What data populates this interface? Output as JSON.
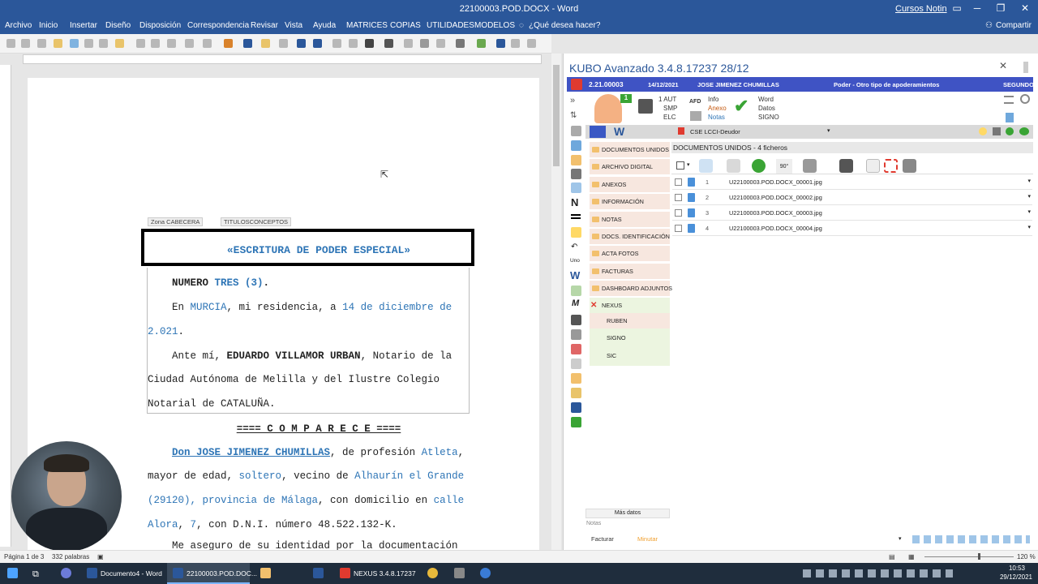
{
  "word": {
    "title": "22100003.POD.DOCX  -  Word",
    "user": "Cursos Notin",
    "menu": [
      "Archivo",
      "Inicio",
      "Insertar",
      "Diseño",
      "Disposición",
      "Correspondencia",
      "Revisar",
      "Vista",
      "Ayuda",
      "MATRICES",
      "COPIAS",
      "UTILIDADES",
      "MODELOS"
    ],
    "tell_me": "¿Qué desea hacer?",
    "share": "Compartir",
    "status_page": "Página 1 de 3",
    "status_words": "332 palabras",
    "zoom": "120 %"
  },
  "doc": {
    "tag_header": "Zona CABECERA",
    "tag_titles": "TITULOSCONCEPTOS",
    "title": "«ESCRITURA DE PODER ESPECIAL»",
    "numero_label": "NUMERO",
    "numero_value": "TRES (3)",
    "numero_end": ".",
    "en": "En",
    "city": "MURCIA",
    "residencia": ", mi residencia, a",
    "date1": "14 de diciembre de",
    "date2": "2.021",
    "dot": ".",
    "ante": "Ante mí,",
    "notary": "EDUARDO VILLAMOR URBAN",
    "notary_rest": ", Notario de la",
    "line_ciudad": "Ciudad Autónoma de Melilla y del Ilustre Colegio",
    "line_notarial": "Notarial de CATALUÑA.",
    "comparece": "==== C O M P A R E C E ====",
    "don_name": "Don JOSE JIMENEZ CHUMILLAS",
    "profesion": ", de profesión",
    "job": "Atleta",
    "comma": ",",
    "mayor": "mayor de edad,",
    "estado": "soltero",
    "vecino": ", vecino de",
    "town": "Alhaurín el Grande",
    "cp": "(29120), provincia de Málaga",
    "domicilio": ", con domicilio en",
    "calle": "calle",
    "street": "Alora",
    "num": "7",
    "dni_text": ", con D.N.I. número 48.522.132-K.",
    "comma2": ",",
    "last_line": "Me aseguro de su identidad por la documentación"
  },
  "kubo": {
    "title": "KUBO Avanzado 3.4.8.17237   28/12",
    "code": "2.21.00003",
    "date": "14/12/2021",
    "client": "JOSE JIMENEZ CHUMILLAS",
    "type": "Poder - Otro tipo de apoderamientos",
    "seq": "SEGUNDO",
    "badge": "1",
    "aut": [
      "1 AUT",
      "SMP",
      "ELC"
    ],
    "info": [
      "Info",
      "Anexo",
      "Notas"
    ],
    "word": [
      "Word",
      "Datos",
      "SIGNO"
    ],
    "afd": "AFD",
    "w": "W",
    "cse": "CSE LCCI-Deudor",
    "nav": [
      "DOCUMENTOS UNIDOS",
      "ARCHIVO DIGITAL",
      "ANEXOS",
      "INFORMACIÓN",
      "NOTAS",
      "DOCS. IDENTIFICACIÓN",
      "ACTA FOTOS",
      "FACTURAS",
      "DASHBOARD ADJUNTOS"
    ],
    "nexus": "NEXUS",
    "sub": [
      "RUBEN",
      "SIGNO",
      "SIC"
    ],
    "section": "DOCUMENTOS UNIDOS - 4 ficheros",
    "rotate": "90°",
    "files": [
      {
        "n": "1",
        "name": "U22100003.POD.DOCX_00001.jpg"
      },
      {
        "n": "2",
        "name": "U22100003.POD.DOCX_00002.jpg"
      },
      {
        "n": "3",
        "name": "U22100003.POD.DOCX_00003.jpg"
      },
      {
        "n": "4",
        "name": "U22100003.POD.DOCX_00004.jpg"
      }
    ],
    "mas_datos": "Más datos",
    "notas": "Notas",
    "facturar": "Facturar",
    "minutar": "Minutar",
    "side_letters": {
      "n": "N",
      "uno": "Uno",
      "w": "W",
      "m": "M"
    }
  },
  "taskbar": {
    "items": [
      "Documento4 - Word",
      "22100003.POD.DOC...",
      "NEXUS   3.4.8.17237"
    ],
    "time": "10:53",
    "date": "29/12/2021"
  }
}
